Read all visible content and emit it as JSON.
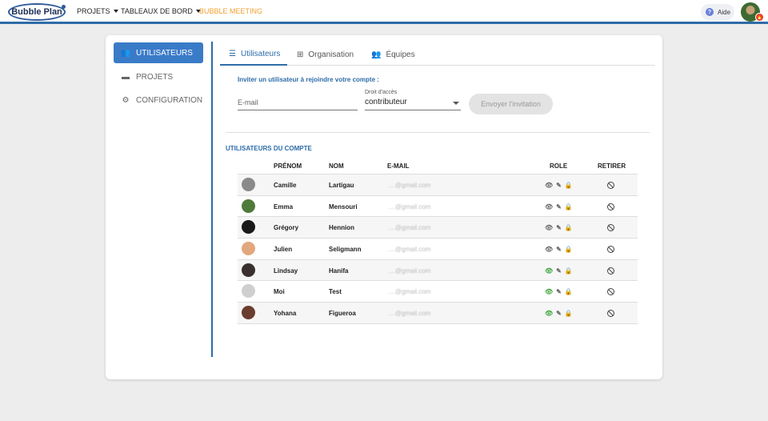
{
  "topbar": {
    "logo": "Bubble Plan",
    "nav": {
      "projets": "PROJETS",
      "tableaux": "TABLEAUX DE BORD",
      "meeting": "BUBBLE MEETING"
    },
    "help_label": "Aide",
    "help_icon": "?"
  },
  "sidebar": {
    "items": [
      {
        "label": "UTILISATEURS",
        "icon": "users-icon"
      },
      {
        "label": "PROJETS",
        "icon": "folder-icon"
      },
      {
        "label": "CONFIGURATION",
        "icon": "gear-icon"
      }
    ]
  },
  "tabs": [
    {
      "label": "Utilisateurs",
      "icon": "list-icon"
    },
    {
      "label": "Organisation",
      "icon": "sitemap-icon"
    },
    {
      "label": "Équipes",
      "icon": "users-icon"
    }
  ],
  "invite": {
    "title": "Inviter un utilisateur à rejoindre votre compte :",
    "email_placeholder": "E-mail",
    "access_label": "Droit d'accès",
    "access_value": "contributeur",
    "send_button": "Envoyer l'invitation"
  },
  "users_section": {
    "title": "UTILISATEURS DU COMPTE",
    "headers": {
      "prenom": "PRÉNOM",
      "nom": "NOM",
      "email": "E-MAIL",
      "role": "ROLE",
      "retirer": "RETIRER"
    },
    "rows": [
      {
        "prenom": "Camille",
        "nom": "Lartigau",
        "email": "....@gmail.com",
        "avatar_color": "#8a8a8a",
        "role_eye_color": "#666666",
        "role_lock_color": "#f0a030"
      },
      {
        "prenom": "Emma",
        "nom": "Mensouri",
        "email": "....@gmail.com",
        "avatar_color": "#4f7a3a",
        "role_eye_color": "#666666",
        "role_lock_color": "#f0a030"
      },
      {
        "prenom": "Grégory",
        "nom": "Hennion",
        "email": "....@gmail.com",
        "avatar_color": "#1a1a1a",
        "role_eye_color": "#666666",
        "role_lock_color": "#f0a030"
      },
      {
        "prenom": "Julien",
        "nom": "Seligmann",
        "email": "....@gmail.com",
        "avatar_color": "#e2a77e",
        "role_eye_color": "#666666",
        "role_lock_color": "#f0a030"
      },
      {
        "prenom": "Lindsay",
        "nom": "Hanifa",
        "email": "....@gmail.com",
        "avatar_color": "#3b3030",
        "role_eye_color": "#3aa33a",
        "role_lock_color": "#666666"
      },
      {
        "prenom": "Moi",
        "nom": "Test",
        "email": "....@gmail.com",
        "avatar_color": "#cfcfcf",
        "role_eye_color": "#3aa33a",
        "role_lock_color": "#666666"
      },
      {
        "prenom": "Yohana",
        "nom": "Figueroa",
        "email": "....@gmail.com",
        "avatar_color": "#6b3d2e",
        "role_eye_color": "#3aa33a",
        "role_lock_color": "#666666"
      }
    ]
  },
  "colors": {
    "accent": "#2e6ca8",
    "sidebar_active": "#3a7bc8",
    "meeting": "#f0a030"
  }
}
